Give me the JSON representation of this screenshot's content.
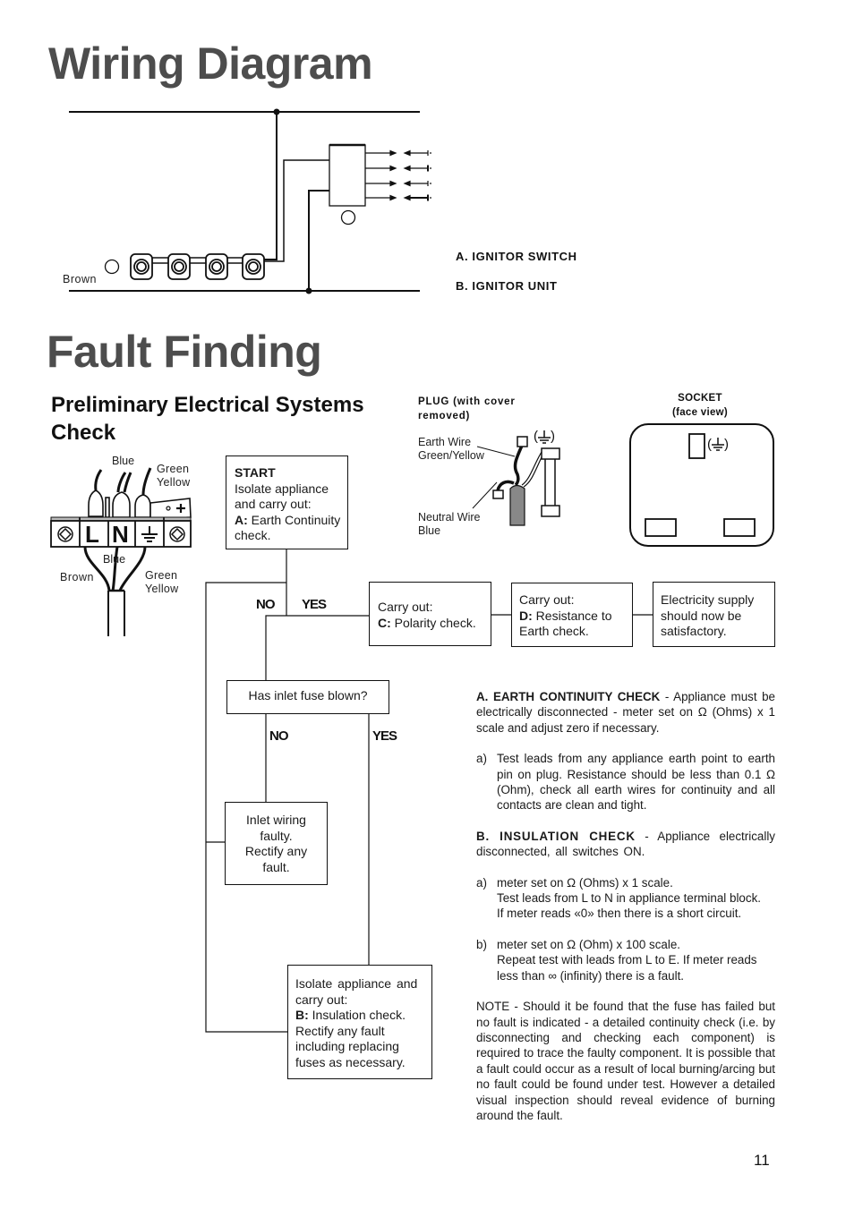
{
  "wiring": {
    "title": "Wiring Diagram",
    "labels": {
      "brown": "Brown"
    },
    "legend": [
      {
        "letter": "A.",
        "label": "IGNITOR SWITCH"
      },
      {
        "letter": "B.",
        "label": "IGNITOR UNIT"
      }
    ]
  },
  "fault": {
    "title": "Fault Finding",
    "section_title_line1": "Preliminary Electrical Systems",
    "section_title_line2": "Check"
  },
  "terminal": {
    "top_blue": "Blue",
    "top_green": "Green",
    "top_yellow": "Yellow",
    "L": "L",
    "N": "N",
    "bottom_blue": "Blue",
    "bottom_brown": "Brown",
    "bottom_green": "Green",
    "bottom_yellow": "Yellow"
  },
  "plug": {
    "title_line1": "PLUG (with cover",
    "title_line2": "removed)",
    "earth_wire_line1": "Earth Wire",
    "earth_wire_line2": "Green/Yellow",
    "neutral_wire_line1": "Neutral Wire",
    "neutral_wire_line2": "Blue",
    "earth_symbol_open": "(",
    "earth_symbol_close": ")"
  },
  "socket": {
    "title_line1": "SOCKET",
    "title_line2": "(face view)"
  },
  "flow": {
    "start": {
      "heading": "START",
      "line1": "Isolate appliance",
      "line2": "and carry out:",
      "key": "A:",
      "line3": " Earth Continuity",
      "line4": "check."
    },
    "no1": "NO",
    "yes1": "YES",
    "polarity": {
      "line1": "Carry out:",
      "key": "C:",
      "line2": " Polarity check."
    },
    "resistance": {
      "line1": "Carry out:",
      "key": "D:",
      "line2": " Resistance to",
      "line3": "Earth check."
    },
    "supply": {
      "line1": "Electricity supply",
      "line2": "should now be",
      "line3": "satisfactory."
    },
    "fuse_question": "Has inlet fuse blown?",
    "no2": "NO",
    "yes2": "YES",
    "inlet": {
      "line1": "Inlet wiring",
      "line2": "faulty.",
      "line3": "Rectify any",
      "line4": "fault."
    },
    "insulation": {
      "line1": "Isolate appliance and",
      "line2": "carry out:",
      "key": "B:",
      "line3": " Insulation check.",
      "line4": "Rectify any fault",
      "line5": "including replacing",
      "line6": "fuses as necessary."
    }
  },
  "instructions": {
    "a_heading": "A. EARTH CONTINUITY CHECK",
    "a_intro": " - Appliance must be electrically disconnected - meter set on Ω (Ohms) x 1 scale and adjust zero if necessary.",
    "a_items": [
      {
        "mark": "a)",
        "text": "Test leads from any appliance earth point to earth pin on plug. Resistance should be less than 0.1 Ω (Ohm), check all earth wires for continuity and all contacts are clean and tight."
      }
    ],
    "b_heading": "B. INSULATION CHECK",
    "b_intro": " - Appliance electrically disconnected, all switches ON.",
    "b_items": [
      {
        "mark": "a)",
        "line1": "meter set on Ω (Ohms) x 1 scale.",
        "line2": "Test leads from L to N in appliance terminal block.",
        "line3": "If meter reads «0» then there is a short circuit."
      },
      {
        "mark": "b)",
        "line1": "meter set on Ω (Ohm) x 100 scale.",
        "line2": "Repeat test with leads from L to E. If meter reads",
        "line3": "less than ∞ (infinity) there is a fault."
      }
    ],
    "note": "NOTE - Should it be found that the fuse has failed but no fault is indicated - a detailed continuity check (i.e. by disconnecting and checking each component) is required to trace the faulty component. It is possible that a fault could occur as a result of local burning/arcing but no fault could be found under test. However a detailed visual inspection should reveal evidence of burning around the fault."
  },
  "page_number": "11"
}
